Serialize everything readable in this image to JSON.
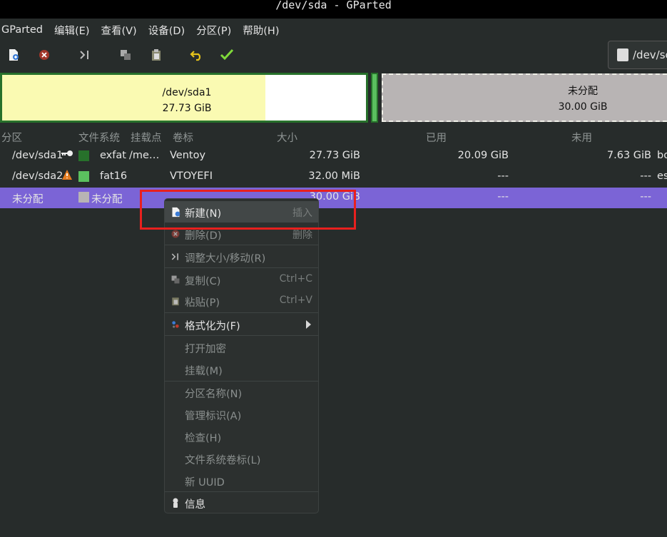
{
  "window": {
    "title": "/dev/sda - GParted"
  },
  "menubar": [
    "GParted",
    "编辑(E)",
    "查看(V)",
    "设备(D)",
    "分区(P)",
    "帮助(H)"
  ],
  "device_selector": {
    "label": "/dev/sc"
  },
  "diskmap": {
    "sda1": {
      "name": "/dev/sda1",
      "size": "27.73 GiB",
      "used_fraction": 0.724
    },
    "unallocated": {
      "name": "未分配",
      "size": "30.00 GiB"
    }
  },
  "columns": [
    "分区",
    "文件系统",
    "挂载点",
    "卷标",
    "大小",
    "已用",
    "未用"
  ],
  "rows": [
    {
      "partition": "/dev/sda1",
      "fs": "exfat",
      "mount": "/me…",
      "label": "Ventoy",
      "size": "27.73 GiB",
      "used": "20.09 GiB",
      "unused": "7.63 GiB",
      "flags": "bo",
      "color": "#27712b"
    },
    {
      "partition": "/dev/sda2",
      "fs": "fat16",
      "mount": "",
      "label": "VTOYEFI",
      "size": "32.00 MiB",
      "used": "---",
      "unused": "---",
      "flags": "es",
      "color": "#5bc05f"
    },
    {
      "partition": "未分配",
      "fs": "未分配",
      "mount": "",
      "label": "",
      "size": "30.00 GiB",
      "used": "---",
      "unused": "---",
      "flags": "",
      "color": "#b8b4b4"
    }
  ],
  "context_menu": {
    "new": {
      "label": "新建(N)",
      "shortcut": "插入"
    },
    "delete": {
      "label": "删除(D)",
      "shortcut": "删除"
    },
    "resize": {
      "label": "调整大小/移动(R)"
    },
    "copy": {
      "label": "复制(C)",
      "shortcut": "Ctrl+C"
    },
    "paste": {
      "label": "粘贴(P)",
      "shortcut": "Ctrl+V"
    },
    "format": {
      "label": "格式化为(F)"
    },
    "open_encryption": {
      "label": "打开加密"
    },
    "mount": {
      "label": "挂载(M)"
    },
    "name_partition": {
      "label": "分区名称(N)"
    },
    "manage_flags": {
      "label": "管理标识(A)"
    },
    "check": {
      "label": "检查(H)"
    },
    "fs_label": {
      "label": "文件系统卷标(L)"
    },
    "new_uuid": {
      "label": "新 UUID"
    },
    "info": {
      "label": "信息"
    }
  },
  "accent_colors": {
    "selection": "#7b64d6",
    "highlight_box": "#e8201e"
  }
}
